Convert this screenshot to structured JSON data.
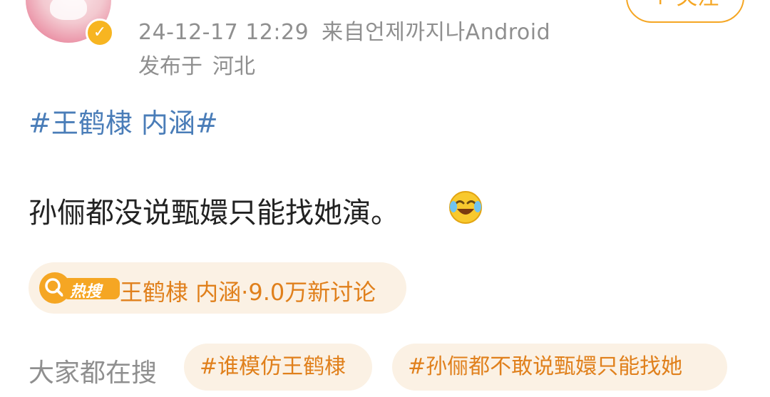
{
  "post": {
    "timestamp": "24-12-17 12:29",
    "source": "来自언제까지나Android",
    "location_prefix": "发布于",
    "location": "河北",
    "follow_label": "+ 关注",
    "topic": "#王鹤棣 内涵#",
    "body": "孙俪都没说甄嬛只能找她演。",
    "emoji_icon": "laughing-tears-emoji"
  },
  "hot_search": {
    "badge": "热搜",
    "text": "王鹤棣 内涵·9.0万新讨论",
    "accent_color": "#f5a623"
  },
  "everyone_search": {
    "label": "大家都在搜",
    "tags": [
      "#谁模仿王鹤棣",
      "#孙俪都不敢说甄嬛只能找她"
    ]
  },
  "colors": {
    "link_blue": "#4a7db8",
    "meta_gray": "#8f8f8f",
    "orange": "#e0801c",
    "pill_bg": "#fbf1e4",
    "verified_gold": "#f7b521"
  }
}
